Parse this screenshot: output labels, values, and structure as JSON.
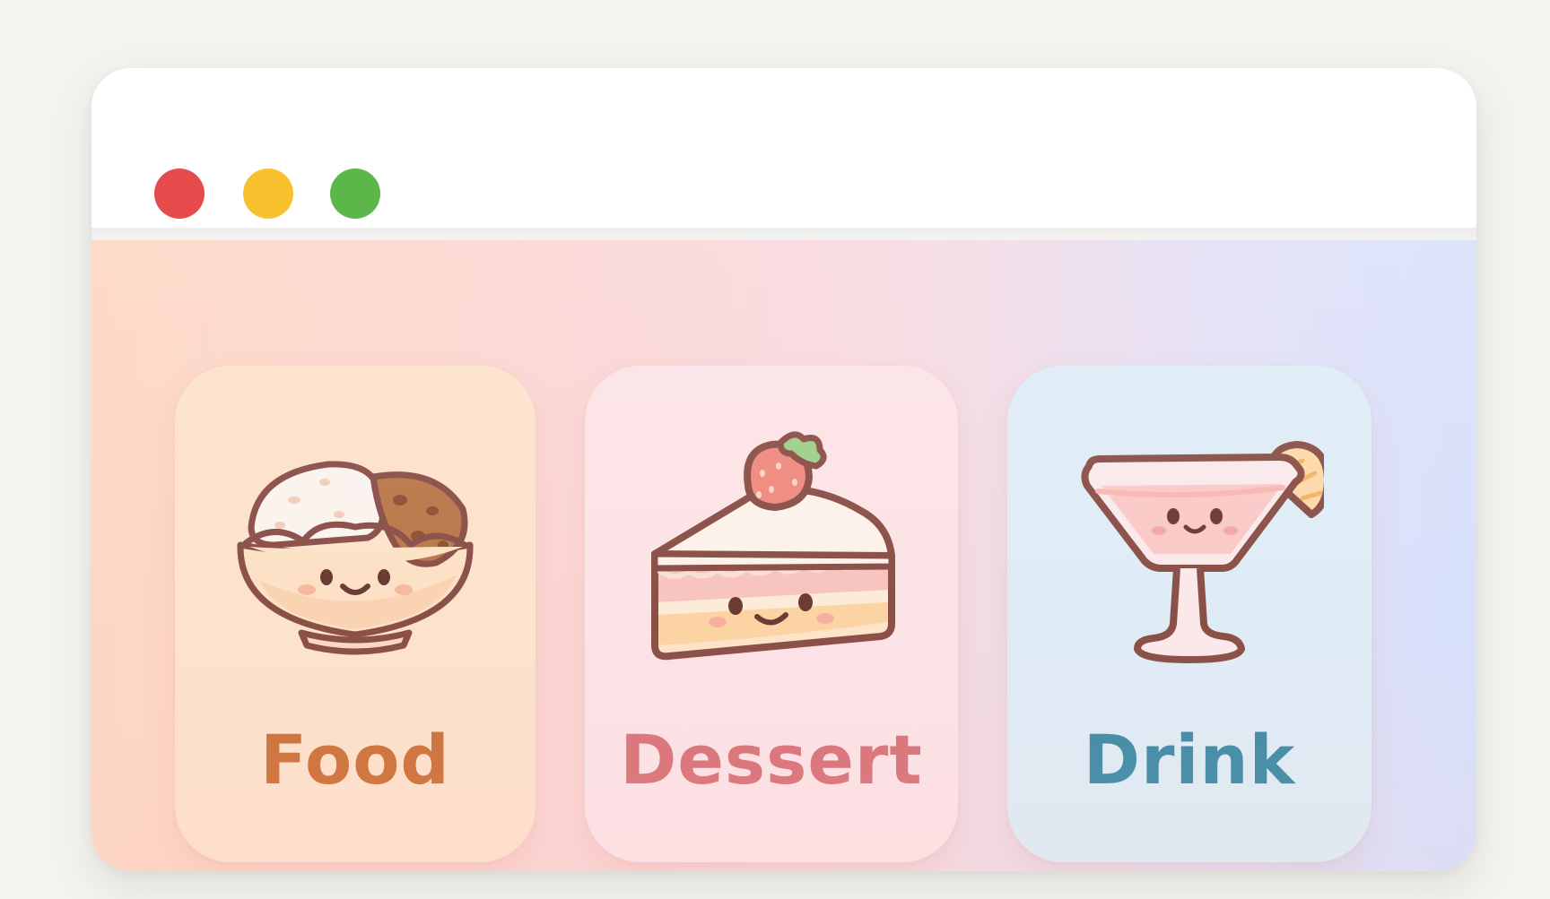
{
  "window": {
    "controls": [
      {
        "name": "close",
        "color": "#e84b4b"
      },
      {
        "name": "minimize",
        "color": "#f6c12d"
      },
      {
        "name": "maximize",
        "color": "#5cb74a"
      }
    ]
  },
  "categories": [
    {
      "label": "Food",
      "icon": "rice-bowl-icon",
      "label_color": "#cd7239",
      "card_color": "#fde2cc"
    },
    {
      "label": "Dessert",
      "icon": "strawberry-cake-icon",
      "label_color": "#d8747a",
      "card_color": "#fce3e6"
    },
    {
      "label": "Drink",
      "icon": "cocktail-icon",
      "label_color": "#3f8ca6",
      "card_color": "#dfecf6"
    }
  ]
}
